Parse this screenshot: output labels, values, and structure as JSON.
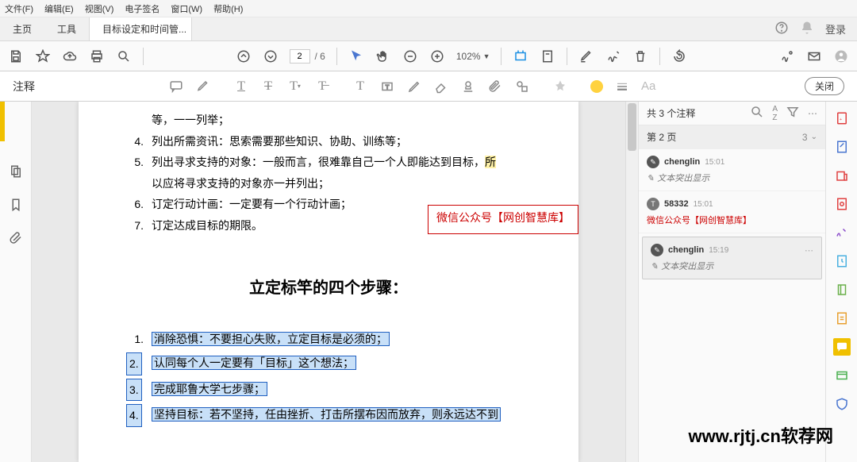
{
  "menubar": [
    "文件(F)",
    "编辑(E)",
    "视图(V)",
    "电子签名",
    "窗口(W)",
    "帮助(H)"
  ],
  "tabs": {
    "home": "主页",
    "tools": "工具",
    "doc": "目标设定和时间管..."
  },
  "topright": {
    "login": "登录"
  },
  "toolbar": {
    "page_current": "2",
    "page_total": "/ 6",
    "zoom": "102%"
  },
  "annobar": {
    "label": "注释",
    "close": "关闭",
    "aa": "Aa"
  },
  "document": {
    "cont_lines": [
      {
        "n": "",
        "t": "等，一一列举；"
      },
      {
        "n": "4.",
        "t": "列出所需资讯：思索需要那些知识、协助、训练等；"
      },
      {
        "n": "5.",
        "t": "列出寻求支持的对象：一般而言，很难靠自己一个人即能达到目标，",
        "hl": "所"
      },
      {
        "n": "",
        "t": "以应将寻求支持的对象亦一并列出；"
      },
      {
        "n": "6.",
        "t": "订定行动计画：一定要有一个行动计画；"
      },
      {
        "n": "7.",
        "t": "订定达成目标的期限。"
      }
    ],
    "redbox": "微信公众号【网创智慧库】",
    "heading": "立定标竿的四个步骤：",
    "steps": [
      {
        "n": "1.",
        "t": "消除恐惧：不要担心失败，立定目标是必须的；"
      },
      {
        "n": "2.",
        "t": "认同每个人一定要有「目标」这个想法；"
      },
      {
        "n": "3.",
        "t": "完成耶鲁大学七步骤；"
      },
      {
        "n": "4.",
        "t": "坚持目标：若不坚持，任由挫折、打击所摆布因而放弃，则永远达不到"
      }
    ]
  },
  "comments_panel": {
    "header": "共 3 个注释",
    "section": {
      "label": "第 2 页",
      "count": "3"
    },
    "items": [
      {
        "avatar": "P",
        "name": "chenglin",
        "time": "15:01",
        "sub": "文本突出显示",
        "type": "hl"
      },
      {
        "avatar": "T",
        "name": "58332",
        "time": "15:01",
        "sub": "微信公众号【网创智慧库】",
        "type": "text"
      },
      {
        "avatar": "P",
        "name": "chenglin",
        "time": "15:19",
        "sub": "文本突出显示",
        "type": "hl",
        "active": true
      }
    ]
  },
  "watermark": "www.rjtj.cn软荐网"
}
